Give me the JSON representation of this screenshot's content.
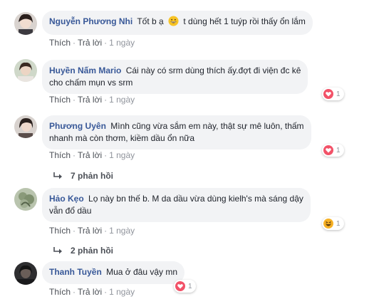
{
  "comments": [
    {
      "name": "Nguyễn Phương Nhi",
      "text_before": "Tốt b ạ",
      "text_after": "t dùng hết 1 tuýp rồi thấy ổn lắm",
      "like": "Thích",
      "reply": "Trả lời",
      "time": "1 ngày",
      "reaction_count": ""
    },
    {
      "name": "Huyền Nấm Mario",
      "text_line1": "Cái này có srm dùng thích ấy.đợt đi viện đc kê",
      "text_line2": "cho chấm mụn vs srm",
      "like": "Thích",
      "reply": "Trả lời",
      "time": "1 ngày",
      "reaction_count": "1"
    },
    {
      "name": "Phương Uyên",
      "text_line1": "Mình cũng vừa sắm em này, thật sự mê luôn, thấm",
      "text_line2": "nhanh mà còn thơm, kiềm dầu ổn nữa",
      "like": "Thích",
      "reply": "Trả lời",
      "time": "1 ngày",
      "reaction_count": "1",
      "replies": "7 phản hồi"
    },
    {
      "name": "Hảo Kẹo",
      "text_line1": "Lọ này bn thế b. M da dầu vừa dùng kielh's mà sáng dậy",
      "text_line2": "vẫn đổ dầu",
      "like": "Thích",
      "reply": "Trả lời",
      "time": "1 ngày",
      "reaction_count": "1",
      "replies": "2 phản hồi"
    },
    {
      "name": "Thanh Tuyền",
      "text_line1": "Mua ở đâu vậy mn",
      "like": "Thích",
      "reply": "Trả lời",
      "time": "1 ngày",
      "reaction_count": "1"
    }
  ],
  "colors": {
    "name": "#385898",
    "bubble": "#f2f3f5",
    "meta": "#90949c",
    "love": "#f25268",
    "haha": "#f7b125"
  },
  "icons": [
    "love-reaction-icon",
    "haha-reaction-icon",
    "reply-arrow-icon",
    "grin-emoji-icon"
  ]
}
